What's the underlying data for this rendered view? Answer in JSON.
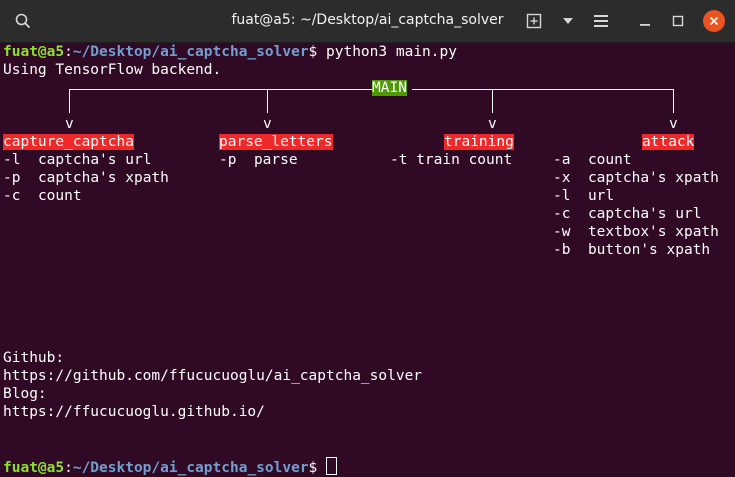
{
  "window": {
    "title": "fuat@a5: ~/Desktop/ai_captcha_solver",
    "icons": [
      "search-icon",
      "new-tab-icon",
      "dropdown-icon",
      "menu-icon",
      "minimize-icon",
      "maximize-icon",
      "close-icon"
    ]
  },
  "colors": {
    "background": "#300a24",
    "user": "#8ae234",
    "path": "#729fcf",
    "red_highlight": "#ef2929",
    "green_highlight": "#4e9a06"
  },
  "prompt": {
    "user_host": "fuat@a5",
    "sep": ":",
    "path": "~/Desktop/ai_captcha_solver",
    "dollar": "$ "
  },
  "command": "python3 main.py",
  "output_line": "Using TensorFlow backend.",
  "tree": {
    "root": "MAIN",
    "arrow": "v",
    "branches": [
      {
        "name": "capture_captcha",
        "options": [
          {
            "flag": "-l",
            "desc": "captcha's url"
          },
          {
            "flag": "-p",
            "desc": "captcha's xpath"
          },
          {
            "flag": "-c",
            "desc": "count"
          }
        ]
      },
      {
        "name": "parse_letters",
        "options": [
          {
            "flag": "-p",
            "desc": "parse"
          }
        ]
      },
      {
        "name": "training",
        "options": [
          {
            "flag": "-t",
            "desc": "train count"
          }
        ]
      },
      {
        "name": "attack",
        "options": [
          {
            "flag": "-a",
            "desc": "count"
          },
          {
            "flag": "-x",
            "desc": "captcha's xpath"
          },
          {
            "flag": "-l",
            "desc": "url"
          },
          {
            "flag": "-c",
            "desc": "captcha's url"
          },
          {
            "flag": "-w",
            "desc": "textbox's xpath"
          },
          {
            "flag": "-b",
            "desc": "button's xpath"
          }
        ]
      }
    ]
  },
  "links": {
    "github_label": "Github:",
    "github_url": "https://github.com/ffucucuoglu/ai_captcha_solver",
    "blog_label": "Blog:",
    "blog_url": "https://ffucucuoglu.github.io/"
  }
}
